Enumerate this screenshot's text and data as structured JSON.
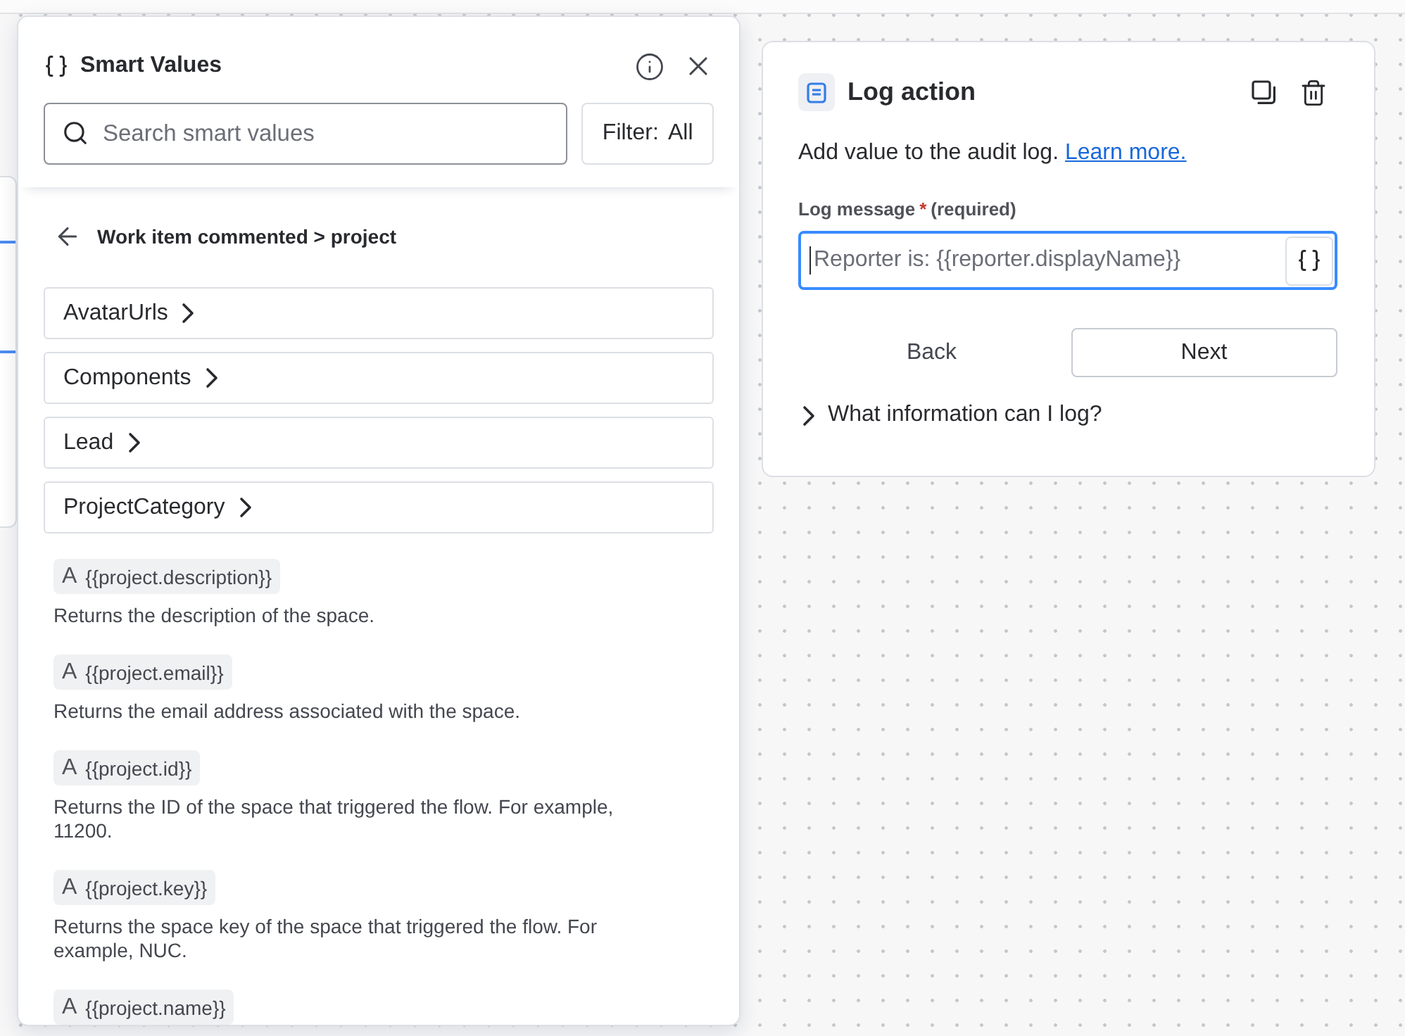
{
  "smart_values_panel": {
    "title": "Smart Values",
    "search": {
      "placeholder": "Search smart values"
    },
    "filter_button": "Filter: All",
    "breadcrumb": "Work item commented > project",
    "groups": [
      {
        "label": "AvatarUrls"
      },
      {
        "label": "Components"
      },
      {
        "label": "Lead"
      },
      {
        "label": "ProjectCategory"
      }
    ],
    "values": [
      {
        "type_icon": "A",
        "token": "{{project.description}}",
        "description": "Returns the description of the space."
      },
      {
        "type_icon": "A",
        "token": "{{project.email}}",
        "description": "Returns the email address associated with the space."
      },
      {
        "type_icon": "A",
        "token": "{{project.id}}",
        "description": "Returns the ID of the space that triggered the flow. For example, 11200."
      },
      {
        "type_icon": "A",
        "token": "{{project.key}}",
        "description": "Returns the space key of the space that triggered the flow. For example, NUC."
      },
      {
        "type_icon": "A",
        "token": "{{project.name}}"
      }
    ]
  },
  "log_action_card": {
    "title": "Log action",
    "description": "Add value to the audit log.",
    "link": "Learn more.",
    "field": {
      "label": "Log message",
      "required_mark": "*",
      "required_note": "(required)",
      "placeholder": "Reporter is: {{reporter.displayName}}",
      "focused": true
    },
    "buttons": [
      {
        "label": "Back",
        "kind": "subtle"
      },
      {
        "label": "Next",
        "kind": "default"
      }
    ],
    "expander": {
      "label": "What information can I log?",
      "expanded": false
    }
  }
}
